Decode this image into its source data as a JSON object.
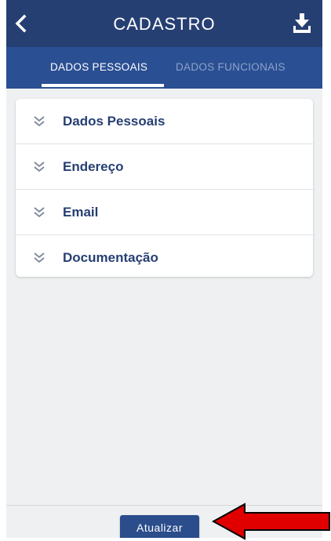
{
  "header": {
    "title": "CADASTRO",
    "back_icon": "chevron-left-icon",
    "download_icon": "download-icon"
  },
  "tabs": [
    {
      "label": "DADOS PESSOAIS",
      "active": true
    },
    {
      "label": "DADOS FUNCIONAIS",
      "active": false
    }
  ],
  "sections": [
    {
      "label": "Dados Pessoais",
      "icon": "double-chevron-down-icon"
    },
    {
      "label": "Endereço",
      "icon": "double-chevron-down-icon"
    },
    {
      "label": "Email",
      "icon": "double-chevron-down-icon"
    },
    {
      "label": "Documentação",
      "icon": "double-chevron-down-icon"
    }
  ],
  "footer": {
    "update_label": "Atualizar"
  },
  "colors": {
    "header_bg": "#263f73",
    "tab_bg": "#2a4f93",
    "accent_text": "#263f73",
    "button_bg": "#2b4d8c",
    "annotation_arrow": "#e00000"
  }
}
